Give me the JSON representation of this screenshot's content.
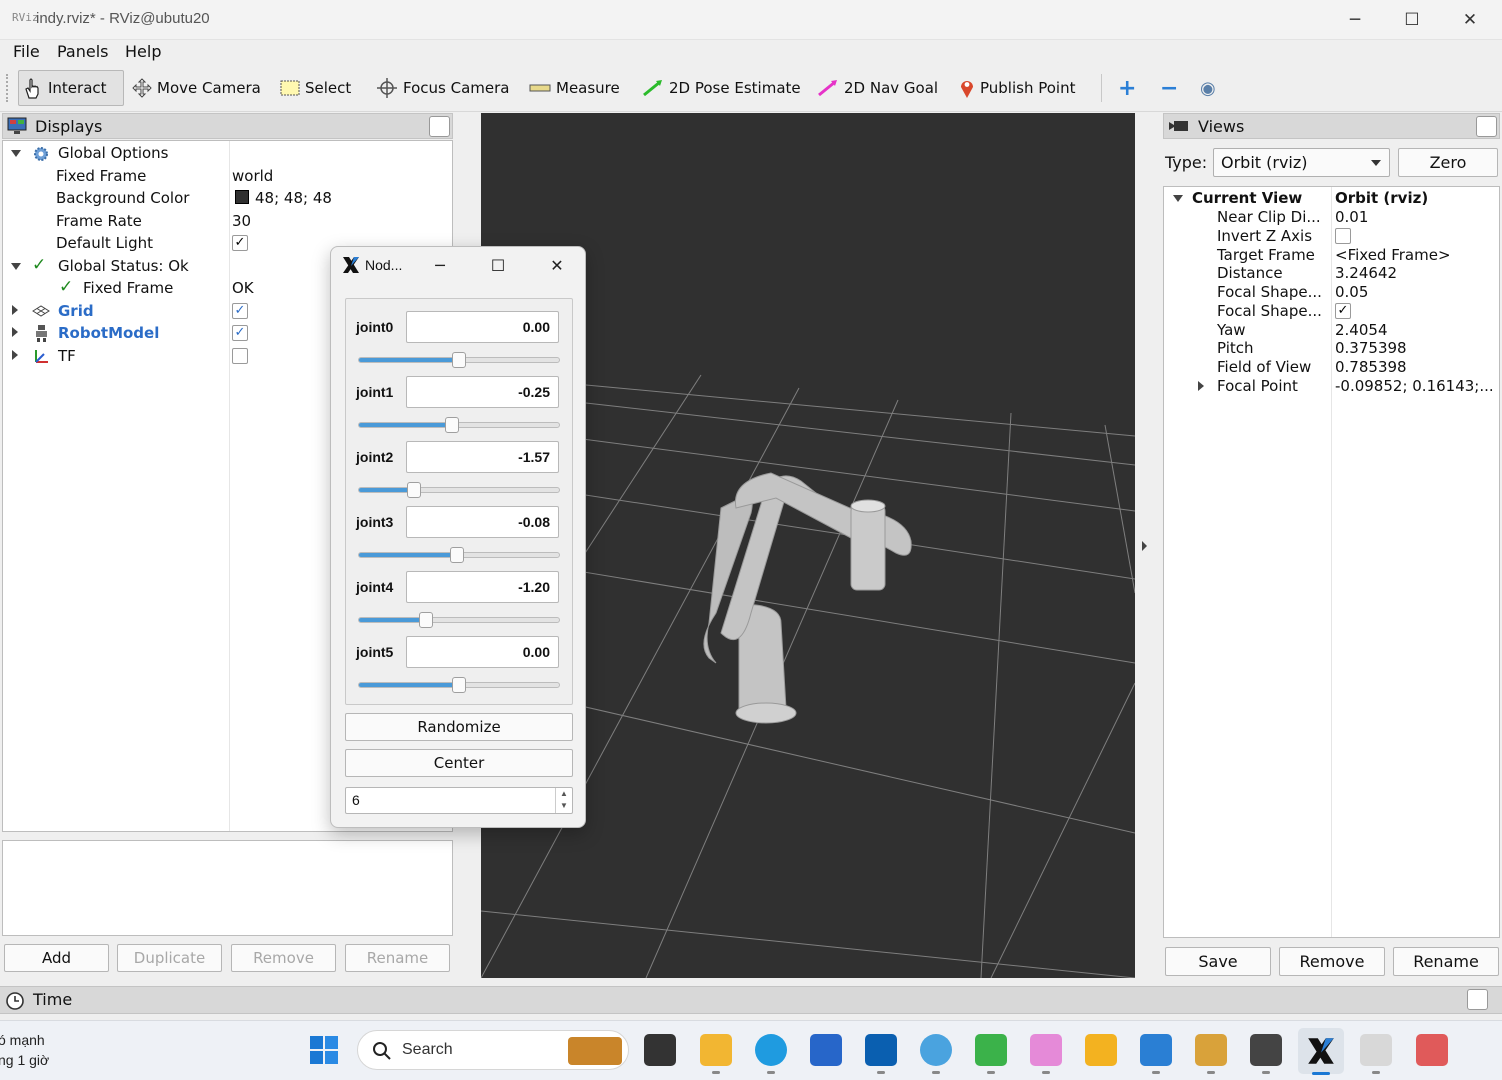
{
  "window": {
    "title": "indy.rviz* - RViz@ubutu20",
    "app_icon_text": "RViz",
    "minimize": "─",
    "maximize": "☐",
    "close": "✕"
  },
  "menu": [
    "File",
    "Panels",
    "Help"
  ],
  "toolbar": {
    "interact": "Interact",
    "move_camera": "Move Camera",
    "select": "Select",
    "focus_camera": "Focus Camera",
    "measure": "Measure",
    "pose_estimate": "2D Pose Estimate",
    "nav_goal": "2D Nav Goal",
    "publish_point": "Publish Point",
    "add_tool": "+",
    "remove_tool": "−",
    "eye_tool": "◉"
  },
  "displays": {
    "title": "Displays",
    "global_options": "Global Options",
    "fixed_frame_label": "Fixed Frame",
    "fixed_frame_value": "world",
    "bg_color_label": "Background Color",
    "bg_color_value": "48; 48; 48",
    "bg_color_swatch": "#303030",
    "frame_rate_label": "Frame Rate",
    "frame_rate_value": "30",
    "default_light_label": "Default Light",
    "global_status": "Global Status: Ok",
    "status_fixed_frame": "Fixed Frame",
    "status_fixed_frame_value": "OK",
    "grid": "Grid",
    "robot_model": "RobotModel",
    "tf": "TF",
    "buttons": {
      "add": "Add",
      "duplicate": "Duplicate",
      "remove": "Remove",
      "rename": "Rename"
    }
  },
  "joint_dialog": {
    "title": "Nod...",
    "joints": [
      {
        "name": "joint0",
        "value": "0.00",
        "slider": 0.5
      },
      {
        "name": "joint1",
        "value": "-0.25",
        "slider": 0.46
      },
      {
        "name": "joint2",
        "value": "-1.57",
        "slider": 0.26
      },
      {
        "name": "joint3",
        "value": "-0.08",
        "slider": 0.49
      },
      {
        "name": "joint4",
        "value": "-1.20",
        "slider": 0.32
      },
      {
        "name": "joint5",
        "value": "0.00",
        "slider": 0.5
      }
    ],
    "randomize": "Randomize",
    "center": "Center",
    "count": "6"
  },
  "views": {
    "title": "Views",
    "type_label": "Type:",
    "type_value": "Orbit (rviz)",
    "zero": "Zero",
    "current_view": "Current View",
    "current_view_type": "Orbit (rviz)",
    "props": [
      {
        "label": "Near Clip Di...",
        "value": "0.01"
      },
      {
        "label": "Invert Z Axis",
        "value": ""
      },
      {
        "label": "Target Frame",
        "value": "<Fixed Frame>"
      },
      {
        "label": "Distance",
        "value": "3.24642"
      },
      {
        "label": "Focal Shape...",
        "value": "0.05"
      },
      {
        "label": "Focal Shape...",
        "value": ""
      },
      {
        "label": "Yaw",
        "value": "2.4054"
      },
      {
        "label": "Pitch",
        "value": "0.375398"
      },
      {
        "label": "Field of View",
        "value": "0.785398"
      },
      {
        "label": "Focal Point",
        "value": "-0.09852; 0.16143;..."
      }
    ],
    "buttons": {
      "save": "Save",
      "remove": "Remove",
      "rename": "Rename"
    }
  },
  "time_panel": {
    "title": "Time"
  },
  "taskbar": {
    "weather_line1": "ó mạnh",
    "weather_line2": "ng 1 giờ",
    "search": "Search"
  }
}
